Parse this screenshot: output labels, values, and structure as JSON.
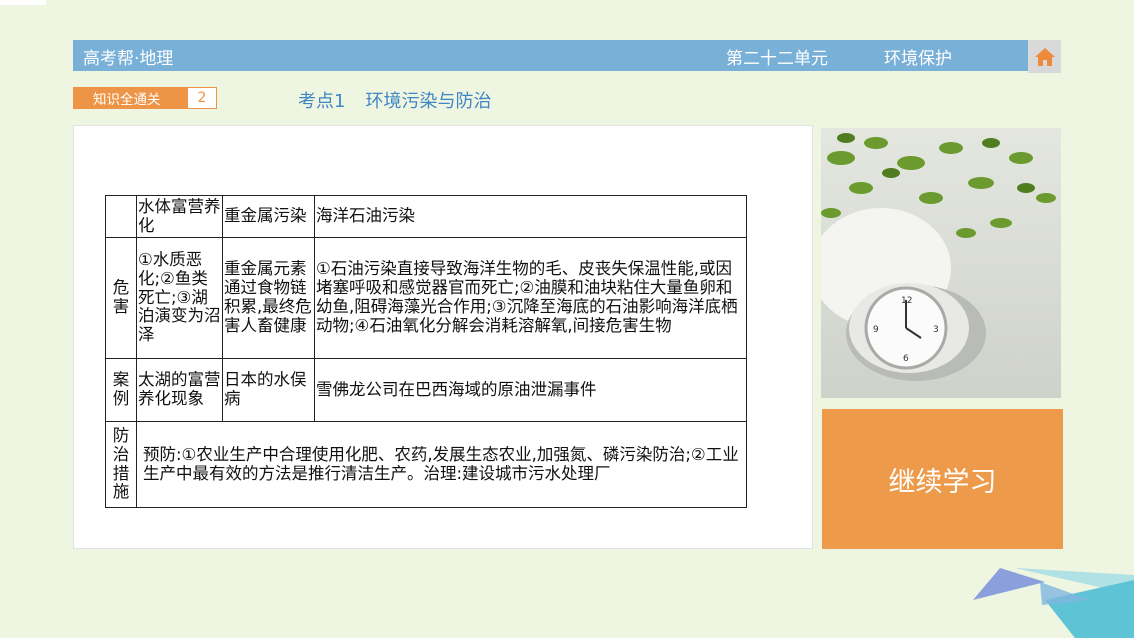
{
  "header": {
    "title": "高考帮·地理",
    "unit": "第二十二单元",
    "topic": "环境保护",
    "home_icon": "home-icon"
  },
  "section": {
    "label": "知识全通关",
    "number": "2"
  },
  "point": {
    "number": "考点1",
    "title": "环境污染与防治"
  },
  "table": {
    "columns": [
      "水体富营养化",
      "重金属污染",
      "海洋石油污染"
    ],
    "rows": [
      {
        "head": "危害",
        "cells": [
          "①水质恶化;②鱼类死亡;③湖泊演变为沼泽",
          "重金属元素通过食物链积累,最终危害人畜健康",
          "①石油污染直接导致海洋生物的毛、皮丧失保温性能,或因堵塞呼吸和感觉器官而死亡;②油膜和油块粘住大量鱼卵和幼鱼,阻碍海藻光合作用;③沉降至海底的石油影响海洋底栖动物;④石油氧化分解会消耗溶解氧,间接危害生物"
        ]
      },
      {
        "head": "案例",
        "cells": [
          "太湖的富营养化现象",
          "日本的水俣病",
          "雪佛龙公司在巴西海域的原油泄漏事件"
        ]
      }
    ],
    "measures": {
      "head": "防治措施",
      "text": "预防:①农业生产中合理使用化肥、农药,发展生态农业,加强氮、磷污染防治;②工业生产中最有效的方法是推行清洁生产。治理:建设城市污水处理厂"
    }
  },
  "continue_button": "继续学习",
  "colors": {
    "background": "#eef5e1",
    "header": "#79b0d8",
    "accent": "#ee9446",
    "title_blue": "#3f86c4"
  }
}
